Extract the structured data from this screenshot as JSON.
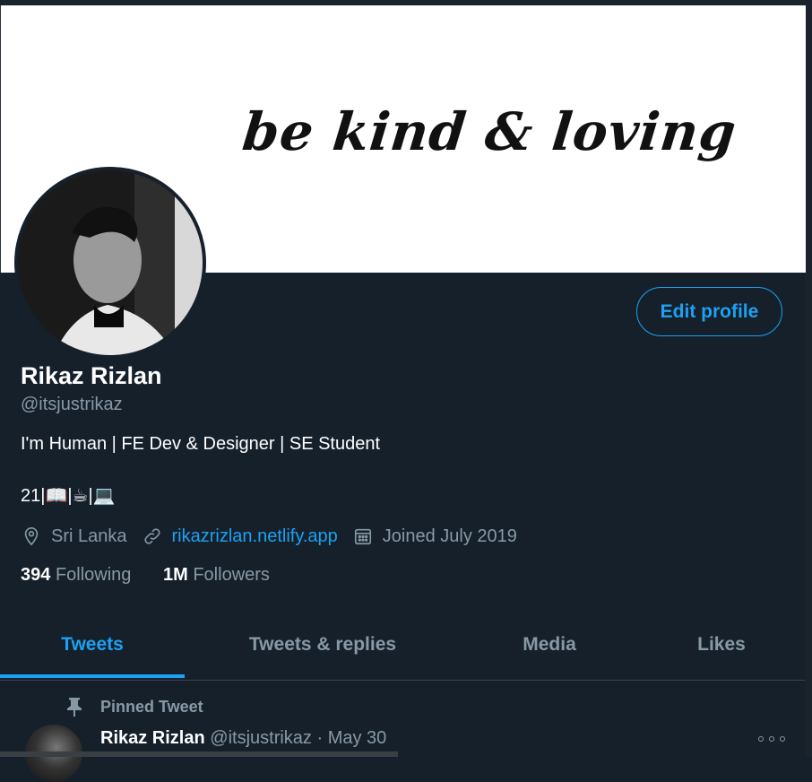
{
  "banner": {
    "text": "be kind & loving"
  },
  "profile": {
    "name": "Rikaz Rizlan",
    "handle": "@itsjustrikaz",
    "bio_line1": "I'm Human | FE Dev & Designer | SE Student",
    "bio_line2": "21|📖|☕|💻",
    "location": "Sri Lanka",
    "website": "rikazrizlan.netlify.app",
    "joined": "Joined July 2019",
    "following_count": "394",
    "following_label": "Following",
    "followers_count": "1M",
    "followers_label": "Followers",
    "edit_label": "Edit profile"
  },
  "tabs": [
    {
      "label": "Tweets",
      "active": true
    },
    {
      "label": "Tweets & replies",
      "active": false
    },
    {
      "label": "Media",
      "active": false
    },
    {
      "label": "Likes",
      "active": false
    }
  ],
  "pinned": {
    "label": "Pinned Tweet",
    "author_name": "Rikaz Rizlan",
    "author_handle": "@itsjustrikaz",
    "separator": "·",
    "date": "May 30"
  },
  "colors": {
    "accent": "#1da1f2",
    "background": "#15202b",
    "muted": "#8899a6",
    "border": "#38444d"
  },
  "icons": [
    "location-icon",
    "link-icon",
    "calendar-icon",
    "pin-icon",
    "more-icon"
  ]
}
